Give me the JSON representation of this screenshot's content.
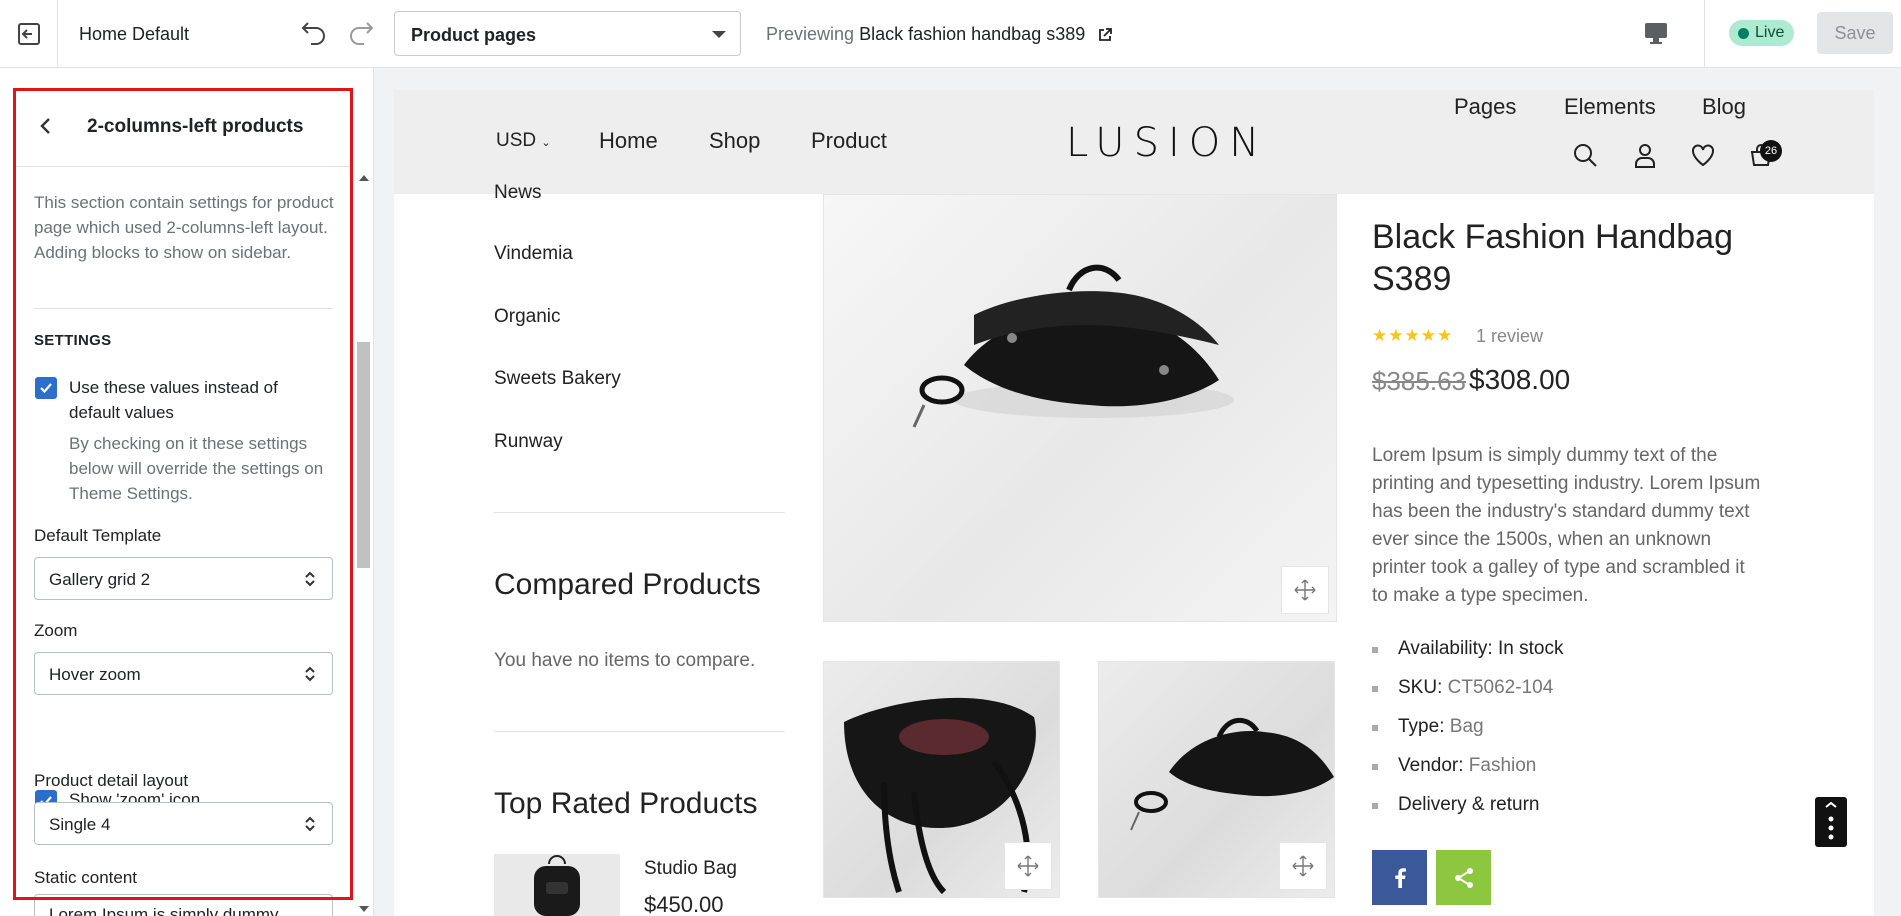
{
  "topbar": {
    "theme_name": "Home Default",
    "page_select_value": "Product pages",
    "previewing_prefix": "Previewing",
    "previewing_product": "Black fashion handbag s389",
    "live_label": "Live",
    "save_label": "Save"
  },
  "sidebar": {
    "title": "2-columns-left products",
    "description": "This section contain settings for product page which used 2-columns-left layout. Adding blocks to show on sidebar.",
    "settings_heading": "SETTINGS",
    "use_values_label": "Use these values instead of default values",
    "use_values_checked": true,
    "use_values_help": "By checking on it these settings below will override the settings on Theme Settings.",
    "default_template_label": "Default Template",
    "default_template_value": "Gallery grid 2",
    "zoom_label": "Zoom",
    "zoom_value": "Hover zoom",
    "show_zoom_icon_label": "Show 'zoom' icon",
    "show_zoom_icon_checked": true,
    "detail_layout_label": "Product detail layout",
    "detail_layout_value": "Single 4",
    "static_content_label": "Static content",
    "static_content_value": "Lorem Ipsum is simply dummy"
  },
  "store": {
    "currency": "USD",
    "nav_left": [
      "Home",
      "Shop",
      "Product"
    ],
    "logo": "LUSION",
    "nav_right": [
      "Pages",
      "Elements",
      "Blog"
    ],
    "cart_count": "26",
    "categories": [
      "News",
      "Vindemia",
      "Organic",
      "Sweets Bakery",
      "Runway"
    ],
    "compared_title": "Compared Products",
    "compared_empty": "You have no items to compare.",
    "top_rated_title": "Top Rated Products",
    "top_rated_item_name": "Studio Bag",
    "top_rated_item_price": "$450.00"
  },
  "product": {
    "title": "Black Fashion Handbag S389",
    "stars": "★★★★★",
    "rating": 5,
    "review_count": "1 review",
    "old_price": "$385.63",
    "price": "$308.00",
    "description": "Lorem Ipsum is simply dummy text of the printing and typesetting industry. Lorem Ipsum has been the industry's standard dummy text ever since the 1500s, when an unknown printer took a galley of type and scrambled it to make a type specimen.",
    "meta": [
      {
        "key": "Availability:",
        "value": "In stock"
      },
      {
        "key": "SKU:",
        "value": "CT5062-104"
      },
      {
        "key": "Type:",
        "value": "Bag"
      },
      {
        "key": "Vendor:",
        "value": "Fashion"
      },
      {
        "key": "Delivery & return",
        "value": ""
      }
    ]
  },
  "colors": {
    "accent_blue": "#2c6ecb",
    "highlight_red": "#e0151a",
    "live_green": "#008060",
    "facebook": "#3b5998",
    "share_green": "#8dc63f"
  }
}
